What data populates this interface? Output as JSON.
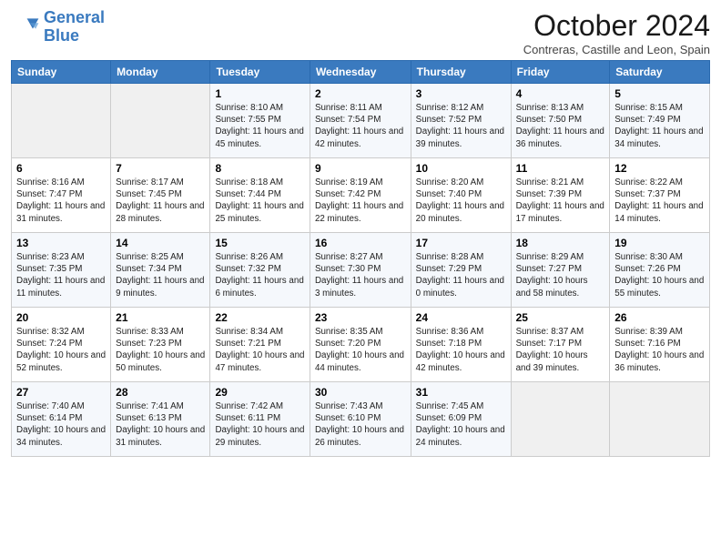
{
  "header": {
    "logo_general": "General",
    "logo_blue": "Blue",
    "title": "October 2024",
    "location": "Contreras, Castille and Leon, Spain"
  },
  "days_of_week": [
    "Sunday",
    "Monday",
    "Tuesday",
    "Wednesday",
    "Thursday",
    "Friday",
    "Saturday"
  ],
  "weeks": [
    [
      {
        "num": "",
        "info": ""
      },
      {
        "num": "",
        "info": ""
      },
      {
        "num": "1",
        "info": "Sunrise: 8:10 AM\nSunset: 7:55 PM\nDaylight: 11 hours and 45 minutes."
      },
      {
        "num": "2",
        "info": "Sunrise: 8:11 AM\nSunset: 7:54 PM\nDaylight: 11 hours and 42 minutes."
      },
      {
        "num": "3",
        "info": "Sunrise: 8:12 AM\nSunset: 7:52 PM\nDaylight: 11 hours and 39 minutes."
      },
      {
        "num": "4",
        "info": "Sunrise: 8:13 AM\nSunset: 7:50 PM\nDaylight: 11 hours and 36 minutes."
      },
      {
        "num": "5",
        "info": "Sunrise: 8:15 AM\nSunset: 7:49 PM\nDaylight: 11 hours and 34 minutes."
      }
    ],
    [
      {
        "num": "6",
        "info": "Sunrise: 8:16 AM\nSunset: 7:47 PM\nDaylight: 11 hours and 31 minutes."
      },
      {
        "num": "7",
        "info": "Sunrise: 8:17 AM\nSunset: 7:45 PM\nDaylight: 11 hours and 28 minutes."
      },
      {
        "num": "8",
        "info": "Sunrise: 8:18 AM\nSunset: 7:44 PM\nDaylight: 11 hours and 25 minutes."
      },
      {
        "num": "9",
        "info": "Sunrise: 8:19 AM\nSunset: 7:42 PM\nDaylight: 11 hours and 22 minutes."
      },
      {
        "num": "10",
        "info": "Sunrise: 8:20 AM\nSunset: 7:40 PM\nDaylight: 11 hours and 20 minutes."
      },
      {
        "num": "11",
        "info": "Sunrise: 8:21 AM\nSunset: 7:39 PM\nDaylight: 11 hours and 17 minutes."
      },
      {
        "num": "12",
        "info": "Sunrise: 8:22 AM\nSunset: 7:37 PM\nDaylight: 11 hours and 14 minutes."
      }
    ],
    [
      {
        "num": "13",
        "info": "Sunrise: 8:23 AM\nSunset: 7:35 PM\nDaylight: 11 hours and 11 minutes."
      },
      {
        "num": "14",
        "info": "Sunrise: 8:25 AM\nSunset: 7:34 PM\nDaylight: 11 hours and 9 minutes."
      },
      {
        "num": "15",
        "info": "Sunrise: 8:26 AM\nSunset: 7:32 PM\nDaylight: 11 hours and 6 minutes."
      },
      {
        "num": "16",
        "info": "Sunrise: 8:27 AM\nSunset: 7:30 PM\nDaylight: 11 hours and 3 minutes."
      },
      {
        "num": "17",
        "info": "Sunrise: 8:28 AM\nSunset: 7:29 PM\nDaylight: 11 hours and 0 minutes."
      },
      {
        "num": "18",
        "info": "Sunrise: 8:29 AM\nSunset: 7:27 PM\nDaylight: 10 hours and 58 minutes."
      },
      {
        "num": "19",
        "info": "Sunrise: 8:30 AM\nSunset: 7:26 PM\nDaylight: 10 hours and 55 minutes."
      }
    ],
    [
      {
        "num": "20",
        "info": "Sunrise: 8:32 AM\nSunset: 7:24 PM\nDaylight: 10 hours and 52 minutes."
      },
      {
        "num": "21",
        "info": "Sunrise: 8:33 AM\nSunset: 7:23 PM\nDaylight: 10 hours and 50 minutes."
      },
      {
        "num": "22",
        "info": "Sunrise: 8:34 AM\nSunset: 7:21 PM\nDaylight: 10 hours and 47 minutes."
      },
      {
        "num": "23",
        "info": "Sunrise: 8:35 AM\nSunset: 7:20 PM\nDaylight: 10 hours and 44 minutes."
      },
      {
        "num": "24",
        "info": "Sunrise: 8:36 AM\nSunset: 7:18 PM\nDaylight: 10 hours and 42 minutes."
      },
      {
        "num": "25",
        "info": "Sunrise: 8:37 AM\nSunset: 7:17 PM\nDaylight: 10 hours and 39 minutes."
      },
      {
        "num": "26",
        "info": "Sunrise: 8:39 AM\nSunset: 7:16 PM\nDaylight: 10 hours and 36 minutes."
      }
    ],
    [
      {
        "num": "27",
        "info": "Sunrise: 7:40 AM\nSunset: 6:14 PM\nDaylight: 10 hours and 34 minutes."
      },
      {
        "num": "28",
        "info": "Sunrise: 7:41 AM\nSunset: 6:13 PM\nDaylight: 10 hours and 31 minutes."
      },
      {
        "num": "29",
        "info": "Sunrise: 7:42 AM\nSunset: 6:11 PM\nDaylight: 10 hours and 29 minutes."
      },
      {
        "num": "30",
        "info": "Sunrise: 7:43 AM\nSunset: 6:10 PM\nDaylight: 10 hours and 26 minutes."
      },
      {
        "num": "31",
        "info": "Sunrise: 7:45 AM\nSunset: 6:09 PM\nDaylight: 10 hours and 24 minutes."
      },
      {
        "num": "",
        "info": ""
      },
      {
        "num": "",
        "info": ""
      }
    ]
  ]
}
